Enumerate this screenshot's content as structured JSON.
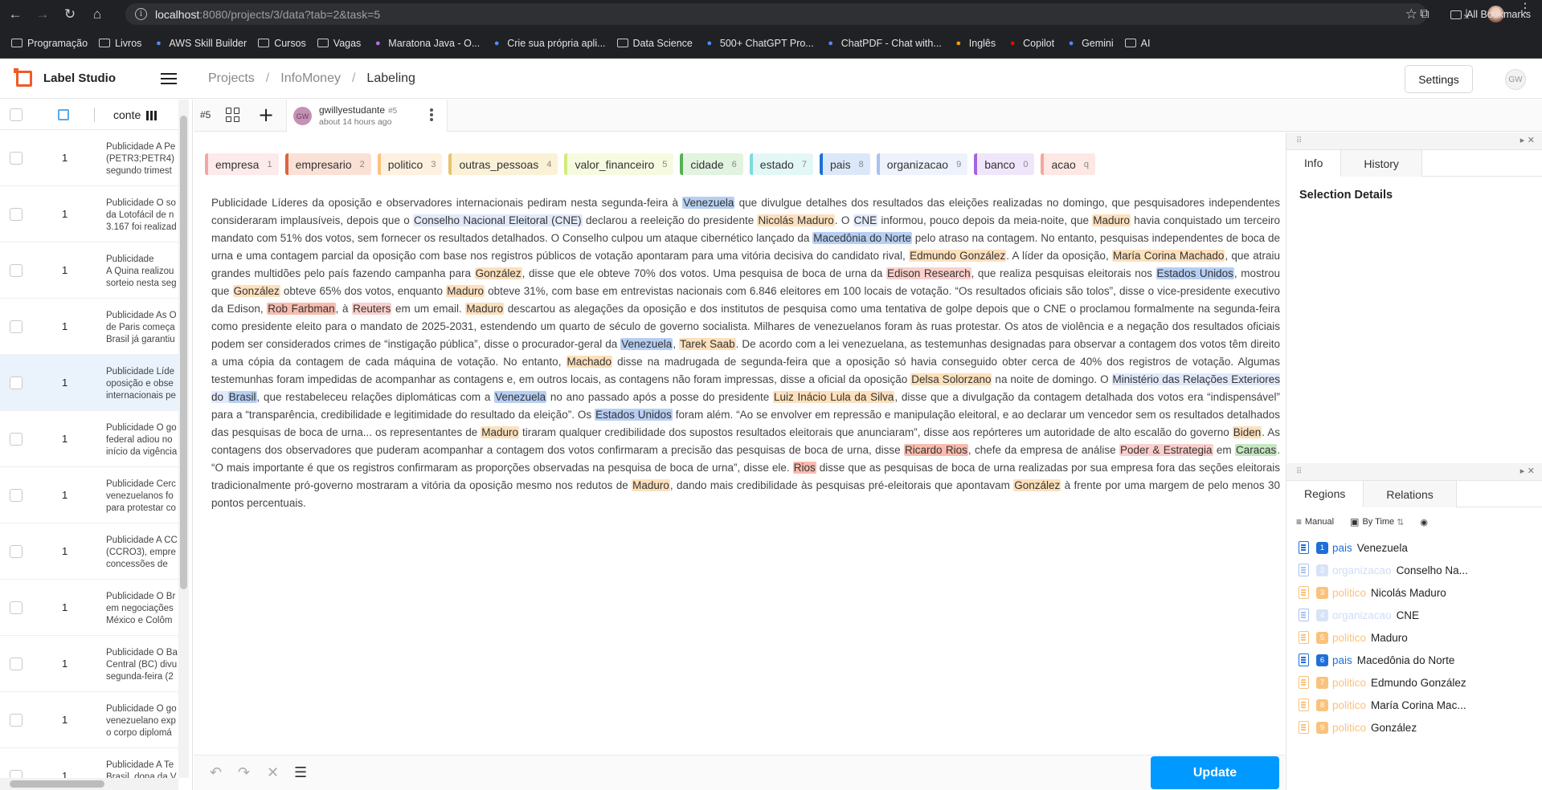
{
  "browser": {
    "url_host": "localhost",
    "url_path": ":8080/projects/3/data?tab=2&task=5",
    "bookmarks": [
      "Programação",
      "Livros",
      "AWS Skill Builder",
      "Cursos",
      "Vagas",
      "Maratona Java - O...",
      "Crie sua própria apli...",
      "Data Science",
      "500+ ChatGPT Pro...",
      "ChatPDF - Chat with...",
      "Inglês",
      "Copilot",
      "Gemini",
      "AI"
    ],
    "all_bookmarks": "All Bookmarks"
  },
  "app": {
    "brand": "Label Studio",
    "breadcrumb": [
      "Projects",
      "InfoMoney",
      "Labeling"
    ],
    "settings_label": "Settings",
    "user_initials": "GW"
  },
  "task_list": {
    "column_label": "conte",
    "rows": [
      {
        "count": "1",
        "text": "Publicidade A Pe\n(PETR3;PETR4) \nsegundo trimest"
      },
      {
        "count": "1",
        "text": "Publicidade O so\nda Lotofácil de n\n3.167 foi realizad"
      },
      {
        "count": "1",
        "text": "Publicidade\nA Quina realizou\nsorteio nesta seg"
      },
      {
        "count": "1",
        "text": "Publicidade As O\nde Paris começa\nBrasil já garantiu"
      },
      {
        "count": "1",
        "text": "Publicidade Líde\noposição e obse\ninternacionais pe"
      },
      {
        "count": "1",
        "text": "Publicidade O go\nfederal adiou no\ninício da vigência"
      },
      {
        "count": "1",
        "text": "Publicidade Cerc\nvenezuelanos fo\npara protestar co"
      },
      {
        "count": "1",
        "text": "Publicidade A CC\n(CCRO3), empre\nconcessões de"
      },
      {
        "count": "1",
        "text": "Publicidade O Br\nem negociações\nMéxico e Colôm"
      },
      {
        "count": "1",
        "text": "Publicidade O Ba\nCentral (BC) divu\nsegunda-feira (2"
      },
      {
        "count": "1",
        "text": "Publicidade O go\nvenezuelano exp\no corpo diplomá"
      },
      {
        "count": "1",
        "text": "Publicidade A Te\nBrasil, dona da V"
      }
    ]
  },
  "toolbar": {
    "task_number": "#5",
    "annotator": "gwillyestudante",
    "annotation_id": "#5",
    "annotator_initials": "GW",
    "time_ago": "about 14 hours ago"
  },
  "labels": [
    {
      "name": "empresa",
      "key": "1",
      "color": "#f4a5a5",
      "bg": "#fdeaea"
    },
    {
      "name": "empresario",
      "key": "2",
      "color": "#e0623e",
      "bg": "#fbe0d5"
    },
    {
      "name": "politico",
      "key": "3",
      "color": "#fbc27c",
      "bg": "#fef1df"
    },
    {
      "name": "outras_pessoas",
      "key": "4",
      "color": "#e8c36a",
      "bg": "#fbf1d6"
    },
    {
      "name": "valor_financeiro",
      "key": "5",
      "color": "#d3ea7a",
      "bg": "#f6fbe0"
    },
    {
      "name": "cidade",
      "key": "6",
      "color": "#52b24e",
      "bg": "#e2f3e0"
    },
    {
      "name": "estado",
      "key": "7",
      "color": "#7fdada",
      "bg": "#e3f7f7"
    },
    {
      "name": "pais",
      "key": "8",
      "color": "#1f6fd8",
      "bg": "#dce8f9"
    },
    {
      "name": "organizacao",
      "key": "9",
      "color": "#a9c2ef",
      "bg": "#edf2fc"
    },
    {
      "name": "banco",
      "key": "0",
      "color": "#a266e0",
      "bg": "#f0e6fb"
    },
    {
      "name": "acao",
      "key": "q",
      "color": "#f3a89a",
      "bg": "#fde8e4"
    }
  ],
  "document": [
    {
      "t": "Publicidade Líderes da oposição e observadores internacionais pediram nesta segunda-feira à "
    },
    {
      "t": "Venezuela",
      "l": "pais"
    },
    {
      "t": " que divulgue detalhes dos resultados das eleições realizadas no domingo, que pesquisadores independentes consideraram implausíveis, depois que o "
    },
    {
      "t": "Conselho Nacional Eleitoral (CNE)",
      "l": "organizacao"
    },
    {
      "t": " declarou a reeleição do presidente "
    },
    {
      "t": "Nicolás Maduro",
      "l": "politico"
    },
    {
      "t": ". O "
    },
    {
      "t": "CNE",
      "l": "organizacao"
    },
    {
      "t": " informou, pouco depois da meia-noite, que "
    },
    {
      "t": "Maduro",
      "l": "politico"
    },
    {
      "t": " havia conquistado um terceiro mandato com 51% dos votos, sem fornecer os resultados detalhados. O Conselho culpou um ataque cibernético lançado da "
    },
    {
      "t": "Macedônia do Norte",
      "l": "pais"
    },
    {
      "t": " pelo atraso na contagem. No entanto, pesquisas independentes de boca de urna e uma contagem parcial da oposição com base nos registros públicos de votação apontaram para uma vitória decisiva do candidato rival, "
    },
    {
      "t": "Edmundo González",
      "l": "politico"
    },
    {
      "t": ". A líder da oposição, "
    },
    {
      "t": "María Corina Machado",
      "l": "politico"
    },
    {
      "t": ", que atraiu grandes multidões pelo país fazendo campanha para "
    },
    {
      "t": "González",
      "l": "politico"
    },
    {
      "t": ", disse que ele obteve 70% dos votos. Uma pesquisa de boca de urna da "
    },
    {
      "t": "Edison Research",
      "l": "empresa"
    },
    {
      "t": ", que realiza pesquisas eleitorais nos "
    },
    {
      "t": "Estados Unidos",
      "l": "pais"
    },
    {
      "t": ", mostrou que "
    },
    {
      "t": "González",
      "l": "politico"
    },
    {
      "t": " obteve 65% dos votos, enquanto "
    },
    {
      "t": "Maduro",
      "l": "politico"
    },
    {
      "t": " obteve 31%, com base em entrevistas nacionais com 6.846 eleitores em 100 locais de votação. “Os resultados oficiais são tolos”, disse o vice-presidente executivo da Edison, "
    },
    {
      "t": "Rob Farbman",
      "l": "empresario"
    },
    {
      "t": ", à "
    },
    {
      "t": "Reuters",
      "l": "empresa"
    },
    {
      "t": " em um email. "
    },
    {
      "t": "Maduro",
      "l": "politico"
    },
    {
      "t": " descartou as alegações da oposição e dos institutos de pesquisa como uma tentativa de golpe depois que o CNE o proclamou formalmente na segunda-feira como presidente eleito para o mandato de 2025-2031, estendendo um quarto de século de governo socialista. Milhares de venezuelanos foram às ruas protestar. Os atos de violência e a negação dos resultados oficiais podem ser considerados crimes de “instigação pública”, disse o procurador-geral da "
    },
    {
      "t": "Venezuela",
      "l": "pais"
    },
    {
      "t": ", "
    },
    {
      "t": "Tarek Saab",
      "l": "politico"
    },
    {
      "t": ". De acordo com a lei venezuelana, as testemunhas designadas para observar a contagem dos votos têm direito a uma cópia da contagem de cada máquina de votação. No entanto, "
    },
    {
      "t": "Machado",
      "l": "politico"
    },
    {
      "t": " disse na madrugada de segunda-feira que a oposição só havia conseguido obter cerca de 40% dos registros de votação. Algumas testemunhas foram impedidas de acompanhar as contagens e, em outros locais, as contagens não foram impressas, disse a oficial da oposição "
    },
    {
      "t": "Delsa Solorzano",
      "l": "politico"
    },
    {
      "t": " na noite de domingo. O "
    },
    {
      "t": "Ministério das Relações Exteriores do ",
      "l": "organizacao"
    },
    {
      "t": "Brasil",
      "l": "pais"
    },
    {
      "t": ", que restabeleceu relações diplomáticas com a "
    },
    {
      "t": "Venezuela",
      "l": "pais"
    },
    {
      "t": " no ano passado após a posse do presidente "
    },
    {
      "t": "Luiz Inácio Lula da Silva",
      "l": "politico"
    },
    {
      "t": ", disse que a divulgação da contagem detalhada dos votos era “indispensável” para a “transparência, credibilidade e legitimidade do resultado da eleição”. Os "
    },
    {
      "t": "Estados Unidos",
      "l": "pais"
    },
    {
      "t": " foram além. “Ao se envolver em repressão e manipulação eleitoral, e ao declarar um vencedor sem os resultados detalhados das pesquisas de boca de urna... os representantes de "
    },
    {
      "t": "Maduro",
      "l": "politico"
    },
    {
      "t": " tiraram qualquer credibilidade dos supostos resultados eleitorais que anunciaram”, disse aos repórteres um autoridade de alto escalão do governo "
    },
    {
      "t": "Biden",
      "l": "politico"
    },
    {
      "t": ". As contagens dos observadores que puderam acompanhar a contagem dos votos confirmaram a precisão das pesquisas de boca de urna, disse "
    },
    {
      "t": "Ricardo Rios",
      "l": "empresario"
    },
    {
      "t": ", chefe da empresa de análise "
    },
    {
      "t": "Poder & Estrategia",
      "l": "empresa"
    },
    {
      "t": " em "
    },
    {
      "t": "Caracas",
      "l": "cidade"
    },
    {
      "t": ". “O mais importante é que os registros confirmaram as proporções observadas na pesquisa de boca de urna”, disse ele. "
    },
    {
      "t": "Rios",
      "l": "empresario"
    },
    {
      "t": " disse que as pesquisas de boca de urna realizadas por sua empresa fora das seções eleitorais tradicionalmente pró-governo mostraram a vitória da oposição mesmo nos redutos de "
    },
    {
      "t": "Maduro",
      "l": "politico"
    },
    {
      "t": ", dando mais credibilidade às pesquisas pré-eleitorais que apontavam "
    },
    {
      "t": "González",
      "l": "politico"
    },
    {
      "t": " à frente por uma margem de pelo menos 30 pontos percentuais."
    }
  ],
  "right_top": {
    "tabs": [
      "Info",
      "History"
    ],
    "active": "Info",
    "selection_title": "Selection Details"
  },
  "right_bottom": {
    "tabs": [
      "Regions",
      "Relations"
    ],
    "active": "Regions",
    "order_manual": "Manual",
    "order_time": "By Time",
    "regions": [
      {
        "n": "1",
        "label": "pais",
        "text": "Venezuela",
        "color": "#1f6fd8",
        "faded": false
      },
      {
        "n": "2",
        "label": "organizacao",
        "text": "Conselho Na...",
        "color": "#a9c2ef",
        "faded": true
      },
      {
        "n": "3",
        "label": "politico",
        "text": "Nicolás Maduro",
        "color": "#fbc27c",
        "faded": false
      },
      {
        "n": "4",
        "label": "organizacao",
        "text": "CNE",
        "color": "#a9c2ef",
        "faded": true
      },
      {
        "n": "5",
        "label": "politico",
        "text": "Maduro",
        "color": "#fbc27c",
        "faded": false
      },
      {
        "n": "6",
        "label": "pais",
        "text": "Macedônia do Norte",
        "color": "#1f6fd8",
        "faded": false
      },
      {
        "n": "7",
        "label": "politico",
        "text": "Edmundo González",
        "color": "#fbc27c",
        "faded": false
      },
      {
        "n": "8",
        "label": "politico",
        "text": "María Corina Mac...",
        "color": "#fbc27c",
        "faded": false
      },
      {
        "n": "9",
        "label": "politico",
        "text": "González",
        "color": "#fbc27c",
        "faded": false
      }
    ]
  },
  "bottom": {
    "update_label": "Update"
  }
}
